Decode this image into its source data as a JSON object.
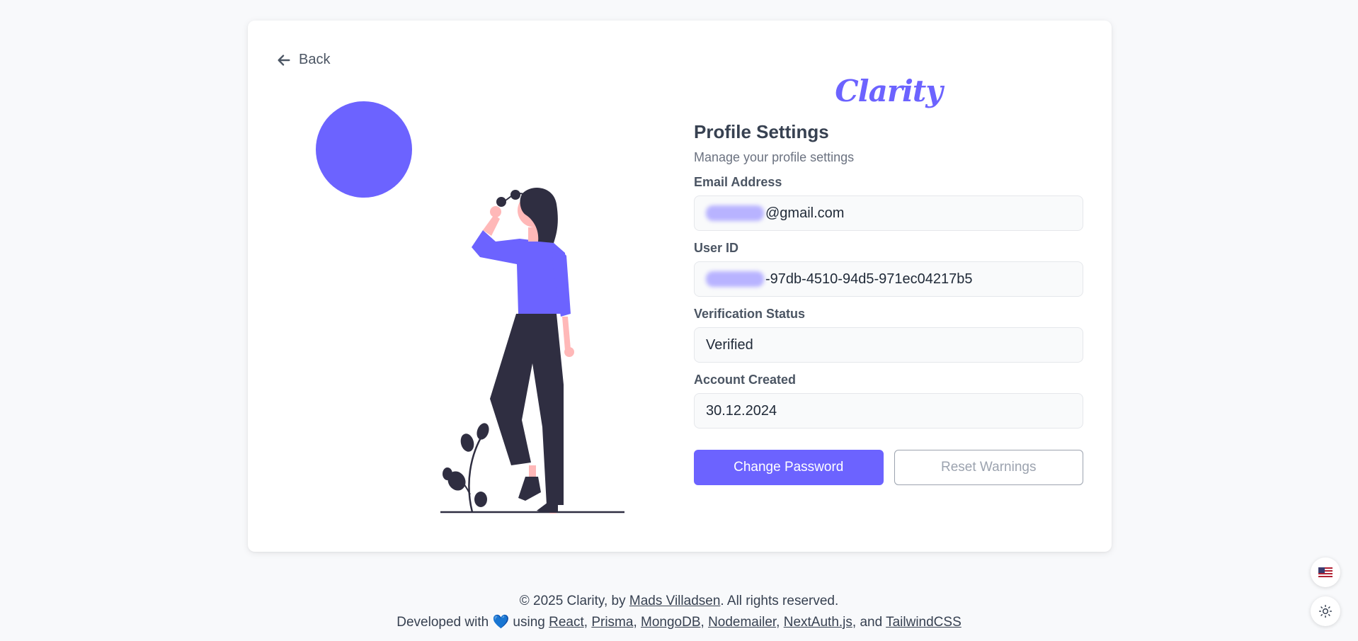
{
  "nav": {
    "back_label": "Back"
  },
  "brand": {
    "logo_text": "Clarity",
    "accent_color": "#6c63ff"
  },
  "profile": {
    "title": "Profile Settings",
    "subtitle": "Manage your profile settings",
    "fields": [
      {
        "label": "Email Address",
        "value": "@gmail.com",
        "redacted": true
      },
      {
        "label": "User ID",
        "value": "-97db-4510-94d5-971ec04217b5",
        "redacted": true
      },
      {
        "label": "Verification Status",
        "value": "Verified",
        "redacted": false
      },
      {
        "label": "Account Created",
        "value": "30.12.2024",
        "redacted": false
      }
    ],
    "change_password_label": "Change Password",
    "reset_warnings_label": "Reset Warnings"
  },
  "footer": {
    "line1_prefix": "© 2025 Clarity, by ",
    "author": "Mads Villadsen",
    "line1_suffix": ". All rights reserved.",
    "line2_prefix": "Developed with ",
    "heart": "💙",
    "line2_using": " using ",
    "tech": [
      "React",
      "Prisma",
      "MongoDB",
      "Nodemailer",
      "NextAuth.js",
      "TailwindCSS"
    ],
    "sep": ", ",
    "and": ", and "
  },
  "floating": {
    "language_icon": "us-flag-icon",
    "theme_icon": "sun-icon"
  }
}
